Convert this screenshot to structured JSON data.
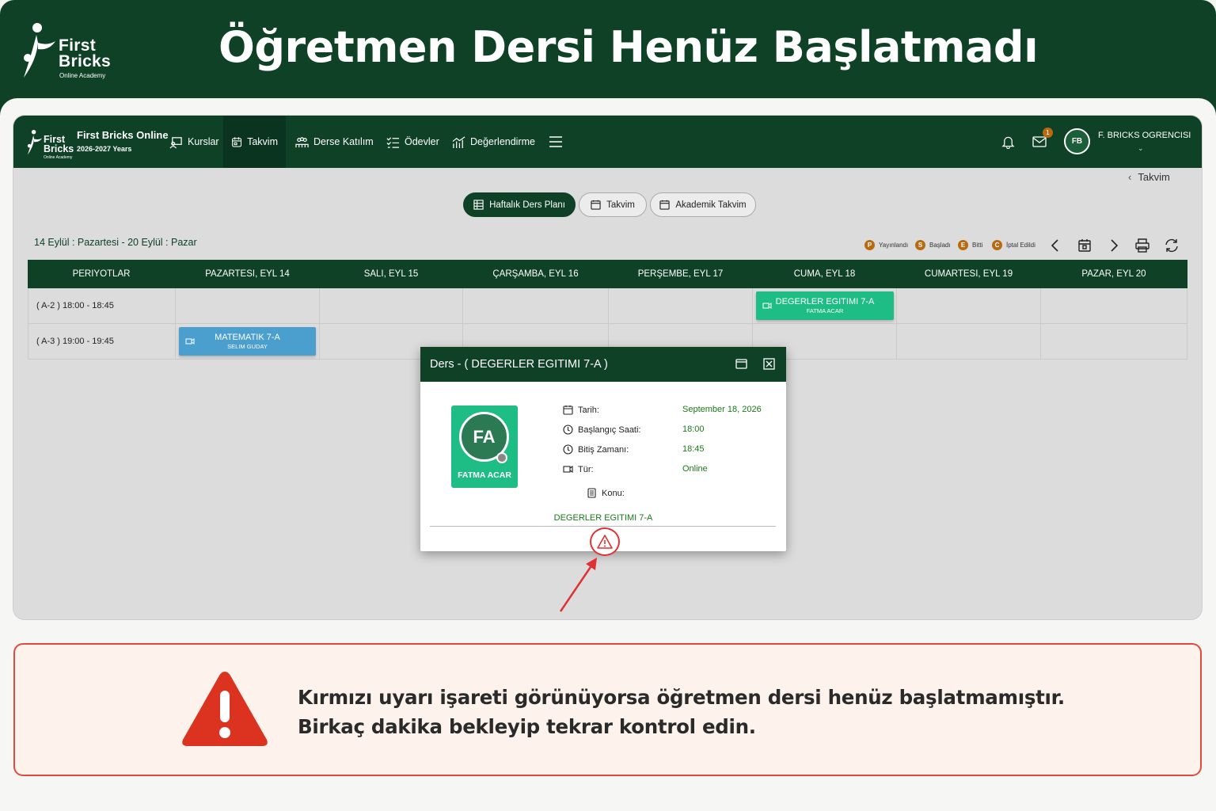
{
  "banner": {
    "title": "Öğretmen Dersi Henüz Başlatmadı"
  },
  "logo": {
    "name_line1": "First",
    "name_line2": "Bricks",
    "tagline": "Online Academy"
  },
  "app": {
    "name": "First Bricks Online",
    "years": "2026-2027 Years",
    "nav": [
      {
        "label": "Kurslar",
        "icon": "presentation-icon"
      },
      {
        "label": "Takvim",
        "icon": "calendar-icon",
        "active": true
      },
      {
        "label": "Derse Katılım",
        "icon": "users-icon"
      },
      {
        "label": "Ödevler",
        "icon": "checklist-icon"
      },
      {
        "label": "Değerlendirme",
        "icon": "chart-icon"
      }
    ],
    "mail_badge": "1",
    "user_initials": "FB",
    "user_name": "F. BRICKS OGRENCISI",
    "colors": {
      "primary": "#0f4127",
      "accent": "#1ebd85",
      "lesson_blue": "#4a9fcf",
      "warning": "#e03232"
    }
  },
  "breadcrumb": "Takvim",
  "view_tabs": [
    "Haftalık Ders Planı",
    "Takvim",
    "Akademik Takvim"
  ],
  "date_range": "14 Eylül : Pazartesi - 20 Eylül : Pazar",
  "legend": [
    {
      "letter": "P",
      "label": "Yayınlandı"
    },
    {
      "letter": "S",
      "label": "Başladı"
    },
    {
      "letter": "E",
      "label": "Bitti"
    },
    {
      "letter": "C",
      "label": "İptal Edildi"
    }
  ],
  "schedule": {
    "headers": [
      "PERIYOTLAR",
      "PAZARTESI, EYL 14",
      "SALI, EYL 15",
      "ÇARŞAMBA, EYL 16",
      "PERŞEMBE, EYL 17",
      "CUMA, EYL 18",
      "CUMARTESI, EYL 19",
      "PAZAR, EYL 20"
    ],
    "periods": [
      "( A-2 ) 18:00 - 18:45",
      "( A-3 ) 19:00 - 19:45"
    ],
    "lessons": [
      {
        "name": "DEGERLER EGITIMI 7-A",
        "teacher": "FATMA ACAR"
      },
      {
        "name": "MATEMATIK 7-A",
        "teacher": "SELIM GUDAY"
      }
    ]
  },
  "modal": {
    "title": "Ders - ( DEGERLER EGITIMI 7-A )",
    "teacher_initials": "FA",
    "teacher_name": "FATMA ACAR",
    "labels": {
      "date": "Tarih:",
      "start": "Başlangıç Saati:",
      "end": "Bitiş Zamanı:",
      "type": "Tür:",
      "topic": "Konu:"
    },
    "values": {
      "date": "September 18, 2026",
      "start": "18:00",
      "end": "18:45",
      "type": "Online",
      "topic": "DEGERLER EGITIMI 7-A"
    }
  },
  "notice": {
    "line1": "Kırmızı uyarı işareti görünüyorsa öğretmen dersi henüz başlatmamıştır.",
    "line2": "Birkaç dakika bekleyip tekrar kontrol edin."
  }
}
